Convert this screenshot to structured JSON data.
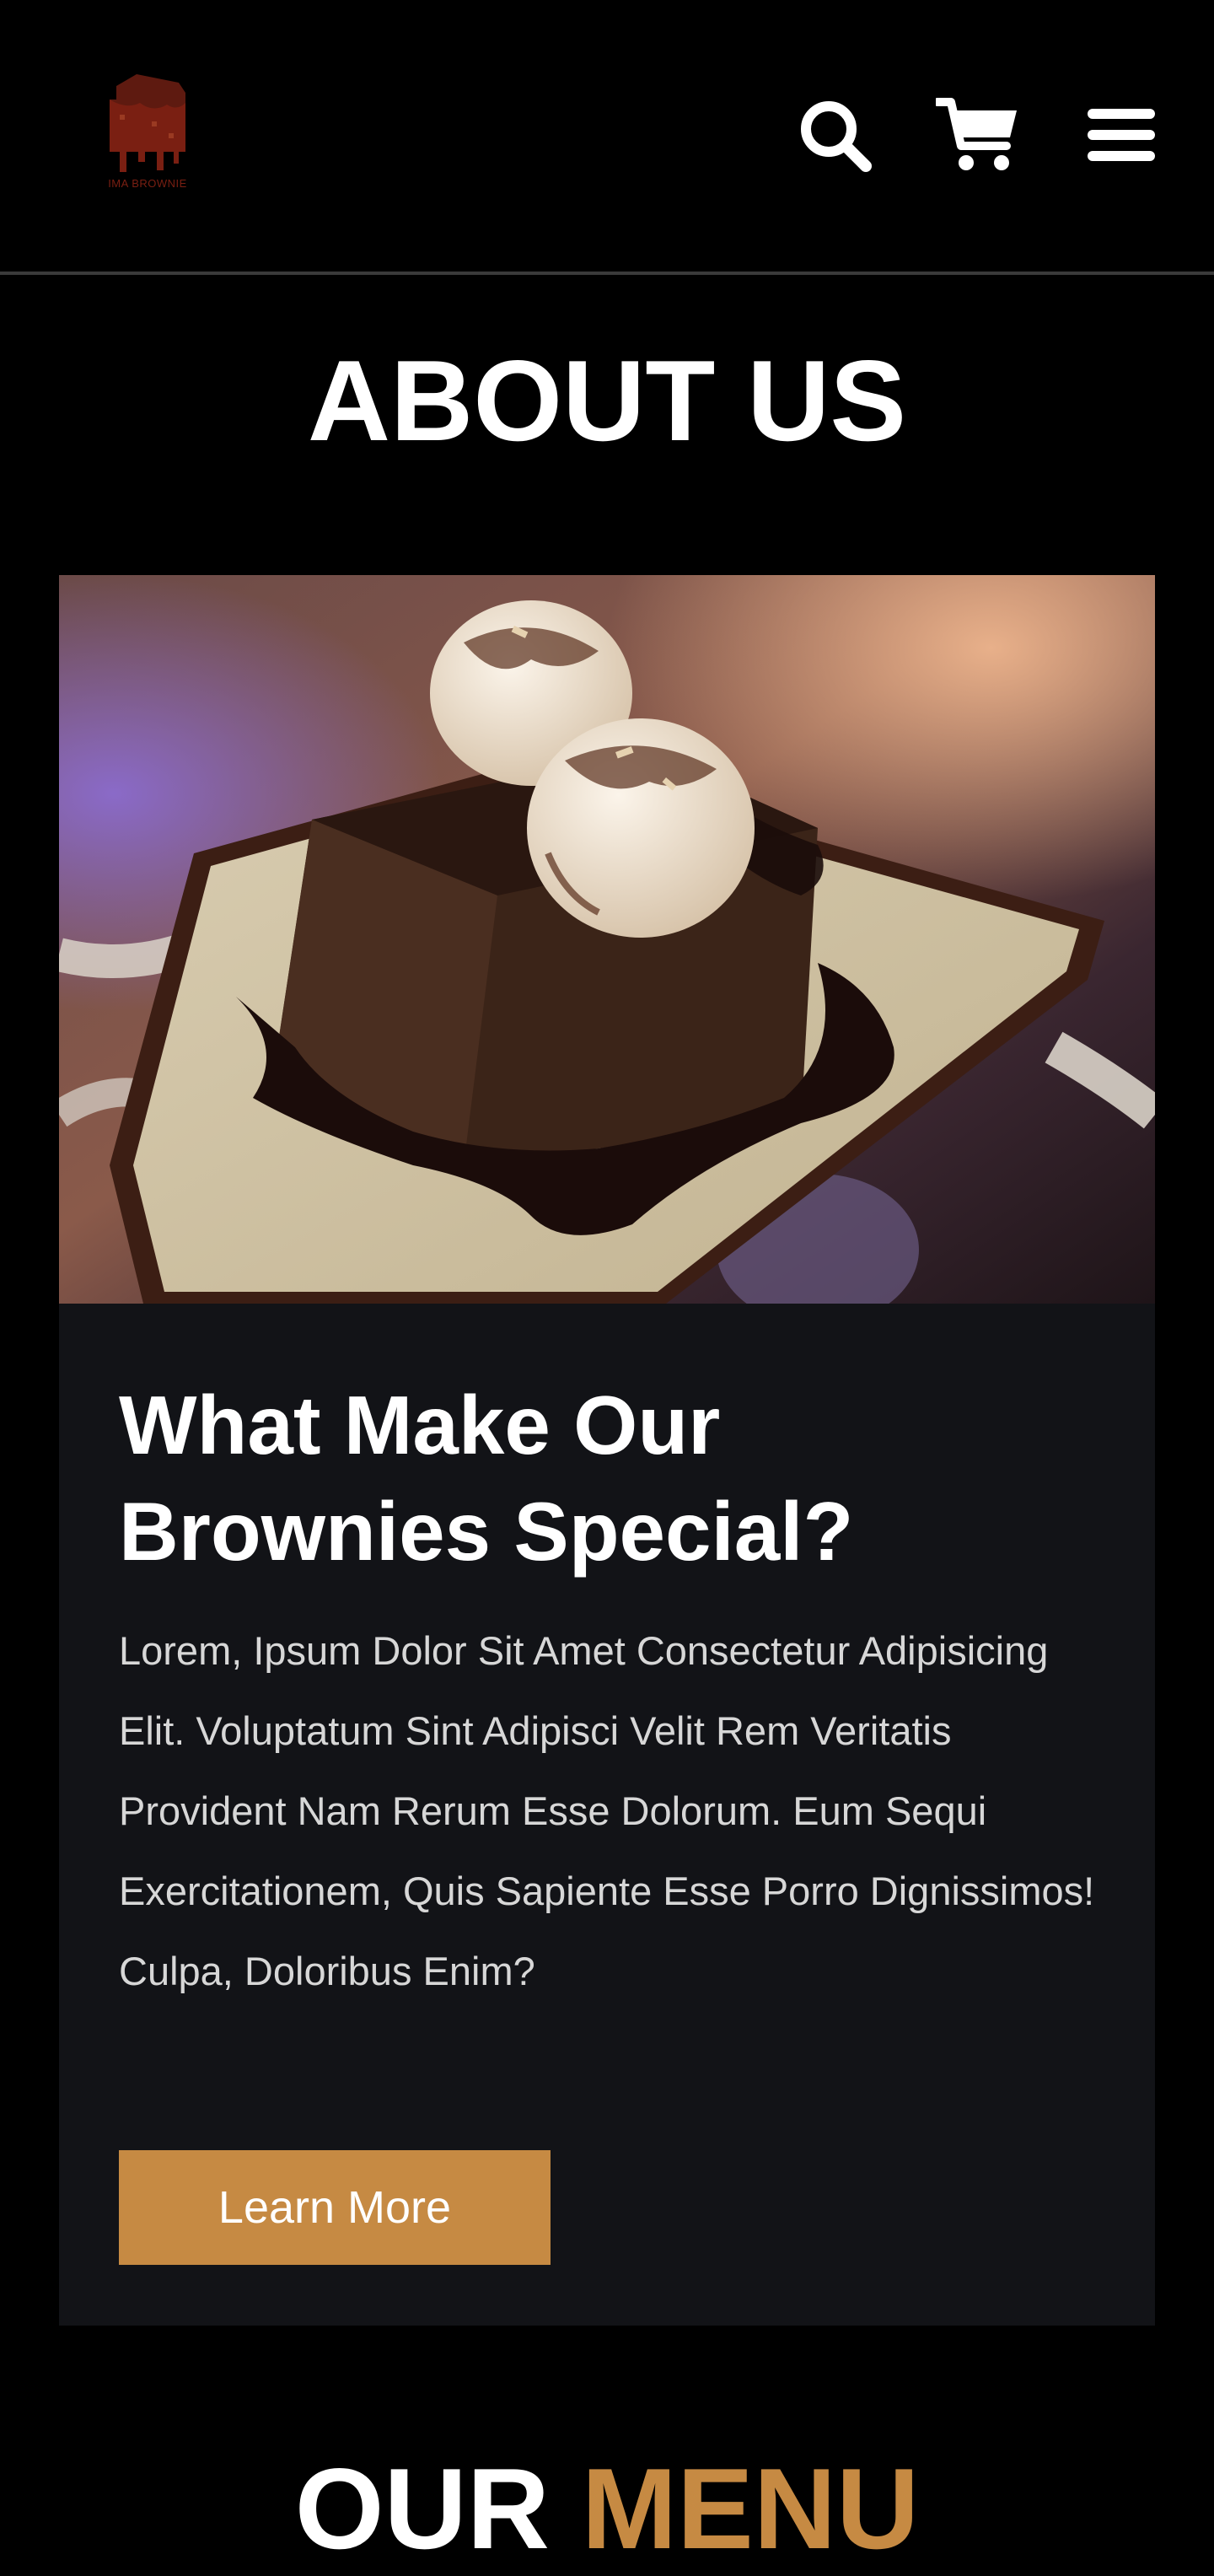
{
  "header": {
    "logo_text": "IMA BROWNIE",
    "icons": {
      "search": "search-icon",
      "cart": "cart-icon",
      "menu": "hamburger-menu-icon"
    }
  },
  "about": {
    "title": "ABOUT US",
    "card": {
      "heading": "What Make Our Brownies Special?",
      "body": "Lorem, Ipsum Dolor Sit Amet Consectetur Adipisicing Elit. Voluptatum Sint Adipisci Velit Rem Veritatis Provident Nam Rerum Esse Dolorum. Eum Sequi Exercitationem, Quis Sapiente Esse Porro Dignissimos! Culpa, Doloribus Enim?",
      "button_label": "Learn More"
    }
  },
  "menu_section": {
    "title_word1": "OUR",
    "title_word2": "MENU"
  },
  "colors": {
    "background": "#000000",
    "card_background": "#121317",
    "accent": "#c68a43",
    "logo": "#7a1f12"
  }
}
